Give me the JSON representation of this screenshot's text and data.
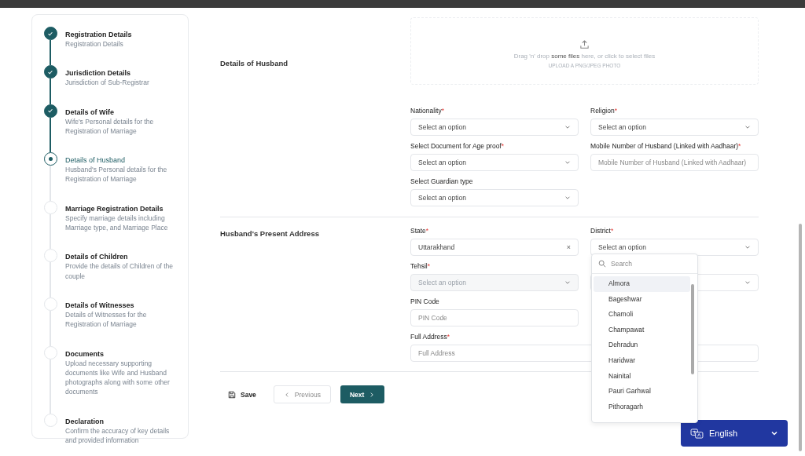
{
  "steps": [
    {
      "title": "Registration Details",
      "description": "Registration Details",
      "completed": true,
      "selected": false
    },
    {
      "title": "Jurisdiction Details",
      "description": "Jurisdiction of Sub-Registrar",
      "completed": true,
      "selected": false
    },
    {
      "title": "Details of Wife",
      "description": "Wife's Personal details for the Registration of Marriage",
      "completed": true,
      "selected": false
    },
    {
      "title": "Details of Husband",
      "description": "Husband's Personal details for the Registration of Marriage",
      "completed": false,
      "selected": true
    },
    {
      "title": "Marriage Registration Details",
      "description": "Specify marriage details including Marriage type, and Marriage Place",
      "completed": false,
      "selected": false
    },
    {
      "title": "Details of Children",
      "description": "Provide the details of Children of the couple",
      "completed": false,
      "selected": false
    },
    {
      "title": "Details of Witnesses",
      "description": "Details of Witnesses for the Registration of Marriage",
      "completed": false,
      "selected": false
    },
    {
      "title": "Documents",
      "description": "Upload necessary supporting documents like Wife and Husband photographs along with some other documents",
      "completed": false,
      "selected": false
    },
    {
      "title": "Declaration",
      "description": "Confirm the accuracy of key details and provided information",
      "completed": false,
      "selected": false
    }
  ],
  "sections": [
    {
      "title": "Details of Husband",
      "upload": {
        "text": "Drag 'n' drop **some files** here, or click to select files",
        "hint": "UPLOAD A PNG/JPEG PHOTO"
      },
      "fields": [
        {
          "kind": "select",
          "label": "Nationality",
          "required_mark": "*",
          "placeholder": "Select an option",
          "disabled": false
        },
        {
          "kind": "select",
          "label": "Religion",
          "required_mark": "*",
          "placeholder": "Select an option",
          "disabled": false
        },
        {
          "kind": "select",
          "label": "Select Document for Age proof",
          "required_mark": "*",
          "placeholder": "Select an option",
          "disabled": false
        },
        {
          "kind": "input",
          "label": "Mobile Number of Husband (Linked with Aadhaar)",
          "required_mark": "*",
          "placeholder": "Mobile Number of Husband (Linked with Aadhaar)"
        },
        {
          "kind": "select",
          "label": "Select Guardian type",
          "placeholder": "Select an option",
          "disabled": false
        }
      ]
    },
    {
      "title": "Husband's Present Address",
      "fields": [
        {
          "kind": "select",
          "label": "State",
          "required_mark": "*",
          "value": "Uttarakhand",
          "clear": "×",
          "disabled": false
        },
        {
          "kind": "select",
          "label": "District",
          "required_mark": "*",
          "placeholder": "Select an option",
          "disabled": false,
          "open": true
        },
        {
          "kind": "select",
          "label": "Tehsil",
          "required_mark": "*",
          "placeholder": "Select an option",
          "disabled": true
        },
        {
          "kind": "select"
        },
        {
          "kind": "input",
          "label": "PIN Code",
          "placeholder": "PIN Code"
        },
        {
          "kind": "gap"
        },
        {
          "kind": "input",
          "label": "Full Address",
          "required_mark": "*",
          "placeholder": "Full Address",
          "wide": true
        }
      ]
    }
  ],
  "dropdown": {
    "search_placeholder": "Search",
    "options": [
      {
        "label": "Almora",
        "selected": true
      },
      {
        "label": "Bageshwar",
        "selected": false
      },
      {
        "label": "Chamoli",
        "selected": false
      },
      {
        "label": "Champawat",
        "selected": false
      },
      {
        "label": "Dehradun",
        "selected": false
      },
      {
        "label": "Haridwar",
        "selected": false
      },
      {
        "label": "Nainital",
        "selected": false
      },
      {
        "label": "Pauri Garhwal",
        "selected": false
      },
      {
        "label": "Pithoragarh",
        "selected": false
      }
    ]
  },
  "actions": {
    "save": "Save",
    "previous": "Previous",
    "next": "Next"
  },
  "language": {
    "label": "English"
  }
}
